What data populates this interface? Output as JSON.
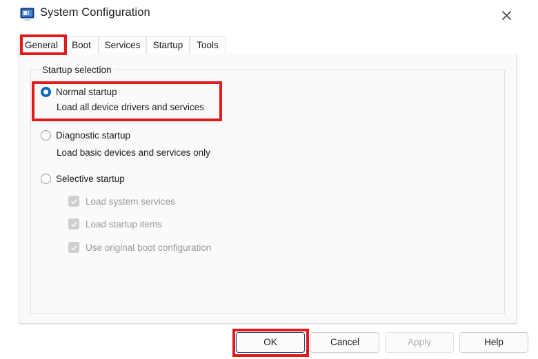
{
  "window": {
    "title": "System Configuration",
    "icon": "system-configuration-monitor-icon",
    "close_label": "✕"
  },
  "tabs": [
    {
      "label": "General",
      "active": true
    },
    {
      "label": "Boot",
      "active": false
    },
    {
      "label": "Services",
      "active": false
    },
    {
      "label": "Startup",
      "active": false
    },
    {
      "label": "Tools",
      "active": false
    }
  ],
  "group": {
    "legend": "Startup selection"
  },
  "startup_options": [
    {
      "label": "Normal startup",
      "description": "Load all device drivers and services",
      "selected": true
    },
    {
      "label": "Diagnostic startup",
      "description": "Load basic devices and services only",
      "selected": false
    },
    {
      "label": "Selective startup",
      "description": "",
      "selected": false
    }
  ],
  "selective_options": [
    {
      "label": "Load system services",
      "checked": true,
      "enabled": false
    },
    {
      "label": "Load startup items",
      "checked": true,
      "enabled": false
    },
    {
      "label": "Use original boot configuration",
      "checked": true,
      "enabled": false
    }
  ],
  "buttons": [
    {
      "label": "OK",
      "state": "default"
    },
    {
      "label": "Cancel",
      "state": "enabled"
    },
    {
      "label": "Apply",
      "state": "disabled"
    },
    {
      "label": "Help",
      "state": "enabled"
    }
  ],
  "annotations": {
    "color": "#e01b1b",
    "targets": [
      "general-tab",
      "normal-startup-option",
      "ok-button"
    ]
  }
}
